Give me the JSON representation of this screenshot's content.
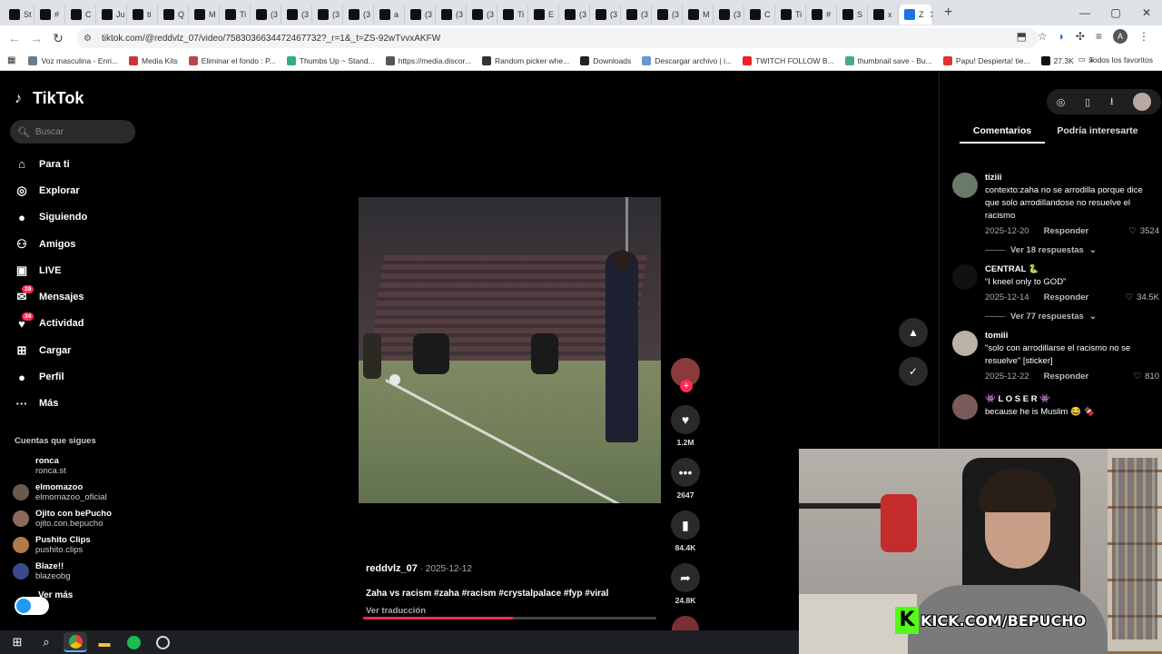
{
  "browser": {
    "tabs": [
      {
        "label": "St"
      },
      {
        "label": "#"
      },
      {
        "label": "C"
      },
      {
        "label": "Ju"
      },
      {
        "label": "ti"
      },
      {
        "label": "Q"
      },
      {
        "label": "M"
      },
      {
        "label": "Ti"
      },
      {
        "label": "(3"
      },
      {
        "label": "(3"
      },
      {
        "label": "(3"
      },
      {
        "label": "(3"
      },
      {
        "label": "a"
      },
      {
        "label": "(3"
      },
      {
        "label": "(3"
      },
      {
        "label": "(3"
      },
      {
        "label": "Ti"
      },
      {
        "label": "E"
      },
      {
        "label": "(3"
      },
      {
        "label": "(3"
      },
      {
        "label": "(3"
      },
      {
        "label": "(3"
      },
      {
        "label": "M"
      },
      {
        "label": "(3"
      },
      {
        "label": "C"
      },
      {
        "label": "Ti"
      },
      {
        "label": "#"
      },
      {
        "label": "S"
      },
      {
        "label": "x"
      }
    ],
    "active_tab": {
      "label": "Z",
      "close": "✕"
    },
    "new_tab": "+",
    "window_controls": {
      "minimize": "—",
      "maximize": "▢",
      "close": "✕"
    },
    "url": "tiktok.com/@reddvlz_07/video/7583036634472467732?_r=1&_t=ZS-92wTvvxAKFW",
    "bookmarks": [
      {
        "label": "Voz masculina - Enri..."
      },
      {
        "label": "Media Kits"
      },
      {
        "label": "Eliminar el fondo : P..."
      },
      {
        "label": "Thumbs Up ~ Stand..."
      },
      {
        "label": "https://media.discor..."
      },
      {
        "label": "Random picker whe..."
      },
      {
        "label": "Downloads"
      },
      {
        "label": "Descargar archivo | i..."
      },
      {
        "label": "TWITCH FOLLOW B..."
      },
      {
        "label": "thumbnail save - Bu..."
      },
      {
        "label": "Papu! Despierta! tie..."
      },
      {
        "label": "27.3K"
      }
    ],
    "bookmarks_more": "»",
    "all_favorites": "Todos los favoritos",
    "profile_letter": "A"
  },
  "sidebar": {
    "brand": "TikTok",
    "search_placeholder": "Buscar",
    "nav": [
      {
        "label": "Para ti",
        "icon": "home-icon"
      },
      {
        "label": "Explorar",
        "icon": "compass-icon"
      },
      {
        "label": "Siguiendo",
        "icon": "following-icon"
      },
      {
        "label": "Amigos",
        "icon": "friends-icon"
      },
      {
        "label": "LIVE",
        "icon": "live-icon"
      },
      {
        "label": "Mensajes",
        "icon": "messages-icon",
        "badge": "19"
      },
      {
        "label": "Actividad",
        "icon": "activity-icon",
        "badge": "34"
      },
      {
        "label": "Cargar",
        "icon": "upload-icon"
      },
      {
        "label": "Perfil",
        "icon": "profile-icon"
      },
      {
        "label": "Más",
        "icon": "more-icon"
      }
    ],
    "following_title": "Cuentas que sigues",
    "following": [
      {
        "name": "ronca",
        "handle": "ronca.st"
      },
      {
        "name": "elmomazoo",
        "handle": "elmomazoo_oficial"
      },
      {
        "name": "Ojito con bePucho",
        "handle": "ojito.con.bepucho"
      },
      {
        "name": "Pushito Clips",
        "handle": "pushito.clips"
      },
      {
        "name": "Blaze!!",
        "handle": "blazeobg"
      }
    ],
    "see_more": "Ver más"
  },
  "video": {
    "author": "reddvlz_07",
    "date": " · 2025-12-12",
    "description": "Zaha vs racism #zaha #racism #crystalpalace #fyp #viral",
    "translate": "Ver traducción",
    "progress": 0.51
  },
  "actions": {
    "likes": "1.2M",
    "comments": "2647",
    "saves": "84.4K",
    "shares": "24.8K"
  },
  "panel": {
    "tab_comments": "Comentarios",
    "tab_interest": "Podría interesarte",
    "comments": [
      {
        "user": "tiziii",
        "text": "contexto:zaha no se arrodilla porque dice que solo arrodillandose no resuelve el racismo",
        "date": "2025-12-20",
        "reply": "Responder",
        "likes": "3524",
        "more": "Ver 18 respuestas"
      },
      {
        "user": "CENTRAL 🐍",
        "text": "“I kneel only to GOD”",
        "date": "2025-12-14",
        "reply": "Responder",
        "likes": "34.5K",
        "more": "Ver 77 respuestas"
      },
      {
        "user": "tomiii",
        "text": "\"solo con arrodillarse el racismo no se resuelve\" [sticker]",
        "date": "2025-12-22",
        "reply": "Responder",
        "likes": "810"
      },
      {
        "user": "👾 L O S E R 👾",
        "text": "because he is Muslim 😂 🍫"
      }
    ]
  },
  "overlay": {
    "kick_letter": "K",
    "kick_text": "KICK.COM/BEPUCHO"
  },
  "colors": {
    "accent": "#fe2c55",
    "kick_green": "#53fc18"
  }
}
